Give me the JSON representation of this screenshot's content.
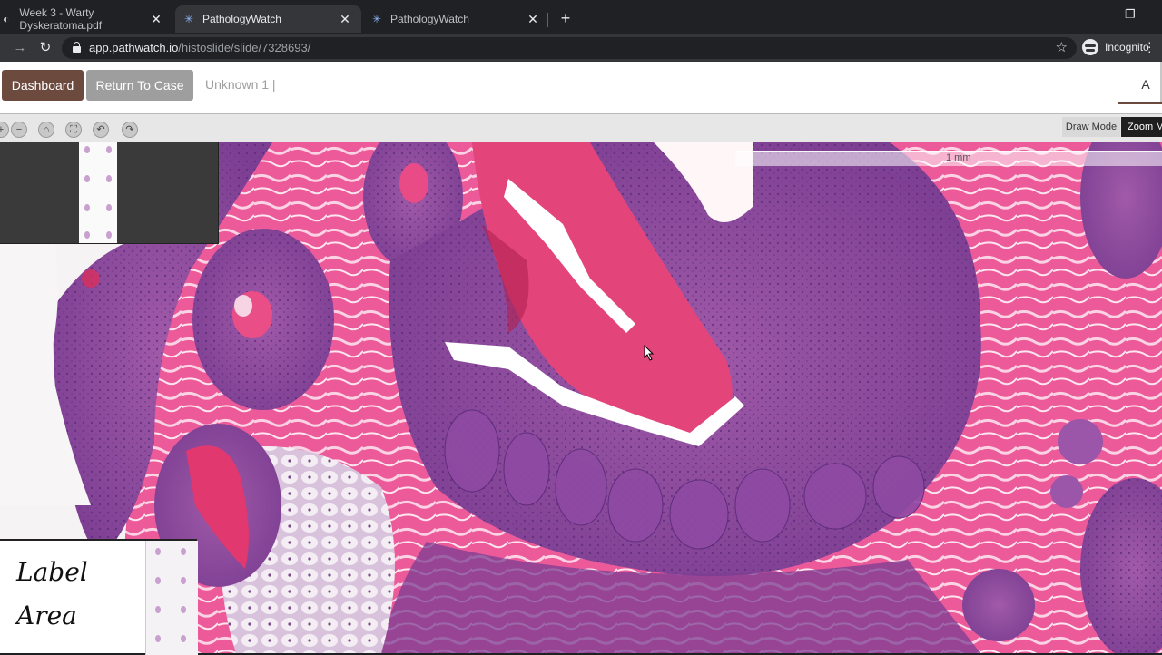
{
  "browser": {
    "tabs": [
      {
        "title": "Week 3 - Warty Dyskeratoma.pdf",
        "active": false
      },
      {
        "title": "PathologyWatch",
        "active": true
      },
      {
        "title": "PathologyWatch",
        "active": false
      }
    ],
    "url_host": "app.pathwatch.io",
    "url_path": "/histoslide/slide/7328693/",
    "profile_label": "Incognito"
  },
  "app": {
    "dashboard_label": "Dashboard",
    "return_label": "Return To Case",
    "case_title": "Unknown 1 |",
    "right_tab_label": "A",
    "brand_color": "#6d4a3e"
  },
  "viewer": {
    "draw_mode_label": "Draw Mode",
    "zoom_mode_label": "Zoom Mode",
    "scale_label": "1 mm",
    "label_area_line1": "Label",
    "label_area_line2": "Area"
  }
}
